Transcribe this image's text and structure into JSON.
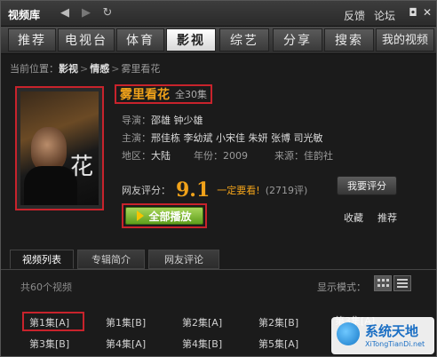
{
  "app": {
    "title": "视频库"
  },
  "toolbar": {
    "back_icon": "◀",
    "forward_icon": "▶",
    "refresh_icon": "↻",
    "feedback": "反馈",
    "forum": "论坛",
    "restore_icon": "◘",
    "close_icon": "✕"
  },
  "nav": {
    "tabs": [
      "推荐",
      "电视台",
      "体育",
      "影视",
      "综艺",
      "分享",
      "搜索",
      "我的视频"
    ],
    "active": 3
  },
  "breadcrumb": {
    "prefix": "当前位置：",
    "items": [
      "影视",
      "情感",
      "雾里看花"
    ],
    "sep": ">"
  },
  "poster": {
    "glyph": "花"
  },
  "detail": {
    "title": "雾里看花",
    "episodes": "全30集",
    "director_label": "导演：",
    "director": "邵雄 钟少雄",
    "cast_label": "主演：",
    "cast": "邢佳栋 李幼斌 小宋佳 朱妍 张博 司光敏",
    "region_label": "地区：",
    "region": "大陆",
    "year_label": "年份：",
    "year": "2009",
    "source_label": "来源：",
    "source": "佳韵社",
    "rating_label": "网友评分：",
    "score": "9.1",
    "verdict": "一定要看!",
    "rating_count": "(2719评)",
    "rate_button": "我要评分",
    "play_button": "全部播放",
    "favorite": "收藏",
    "recommend": "推荐"
  },
  "list": {
    "tabs": [
      "视频列表",
      "专辑简介",
      "网友评论"
    ],
    "active": 0,
    "total": "共60个视频",
    "display_mode": "显示模式：",
    "episodes_row1": [
      "第1集[A]",
      "第1集[B]",
      "第2集[A]",
      "第2集[B]",
      "第3集[A]"
    ],
    "episodes_row2": [
      "第3集[B]",
      "第4集[A]",
      "第4集[B]",
      "第5集[A]"
    ]
  },
  "watermark": {
    "title": "系统天地",
    "subtitle": "XiTongTianDi.net"
  },
  "colors": {
    "accent": "#f0a21a",
    "highlight_border": "#c8232c",
    "play_green": "#5f9e1c"
  }
}
